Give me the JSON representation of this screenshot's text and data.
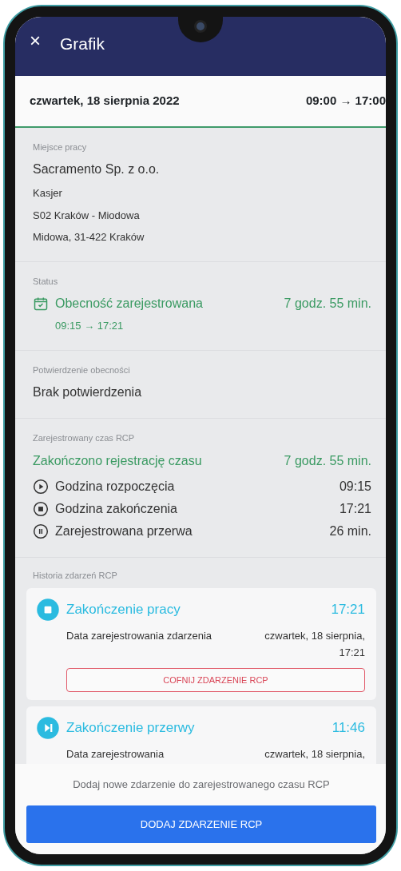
{
  "header": {
    "close": "×",
    "title": "Grafik"
  },
  "day": {
    "date": "czwartek, 18 sierpnia 2022",
    "hours": "09:00 → 17:00"
  },
  "workplace": {
    "label": "Miejsce pracy",
    "company": "Sacramento Sp. z o.o.",
    "lines": [
      "Kasjer",
      "S02 Kraków - Miodowa",
      "Midowa, 31-422 Kraków"
    ]
  },
  "status": {
    "label": "Status",
    "title": "Obecność zarejestrowana",
    "duration": "7 godz. 55 min.",
    "range": "09:15 → 17:21"
  },
  "confirmation": {
    "label": "Potwierdzenie obecności",
    "value": "Brak potwierdzenia"
  },
  "rcp": {
    "label": "Zarejestrowany czas RCP",
    "summary": "Zakończono rejestrację czasu",
    "duration": "7 godz. 55 min.",
    "rows": [
      {
        "kind": "start",
        "label": "Godzina rozpoczęcia",
        "value": "09:15"
      },
      {
        "kind": "stop",
        "label": "Godzina zakończenia",
        "value": "17:21"
      },
      {
        "kind": "pause",
        "label": "Zarejestrowana przerwa",
        "value": "26 min."
      }
    ]
  },
  "history": {
    "label": "Historia zdarzeń RCP",
    "events": [
      {
        "kind": "work_end",
        "title": "Zakończenie pracy",
        "time": "17:21",
        "detail_label": "Data zarejestrowania zdarzenia",
        "detail_value": "czwartek, 18 sierpnia, 17:21",
        "action": "COFNIJ ZDARZENIE RCP"
      },
      {
        "kind": "break_end",
        "title": "Zakończenie przerwy",
        "time": "11:46",
        "detail_label": "Data zarejestrowania",
        "detail_value": "czwartek, 18 sierpnia,"
      }
    ]
  },
  "footer": {
    "hint": "Dodaj nowe zdarzenie do zarejestrowanego czasu RCP",
    "button": "DODAJ ZDARZENIE RCP"
  }
}
